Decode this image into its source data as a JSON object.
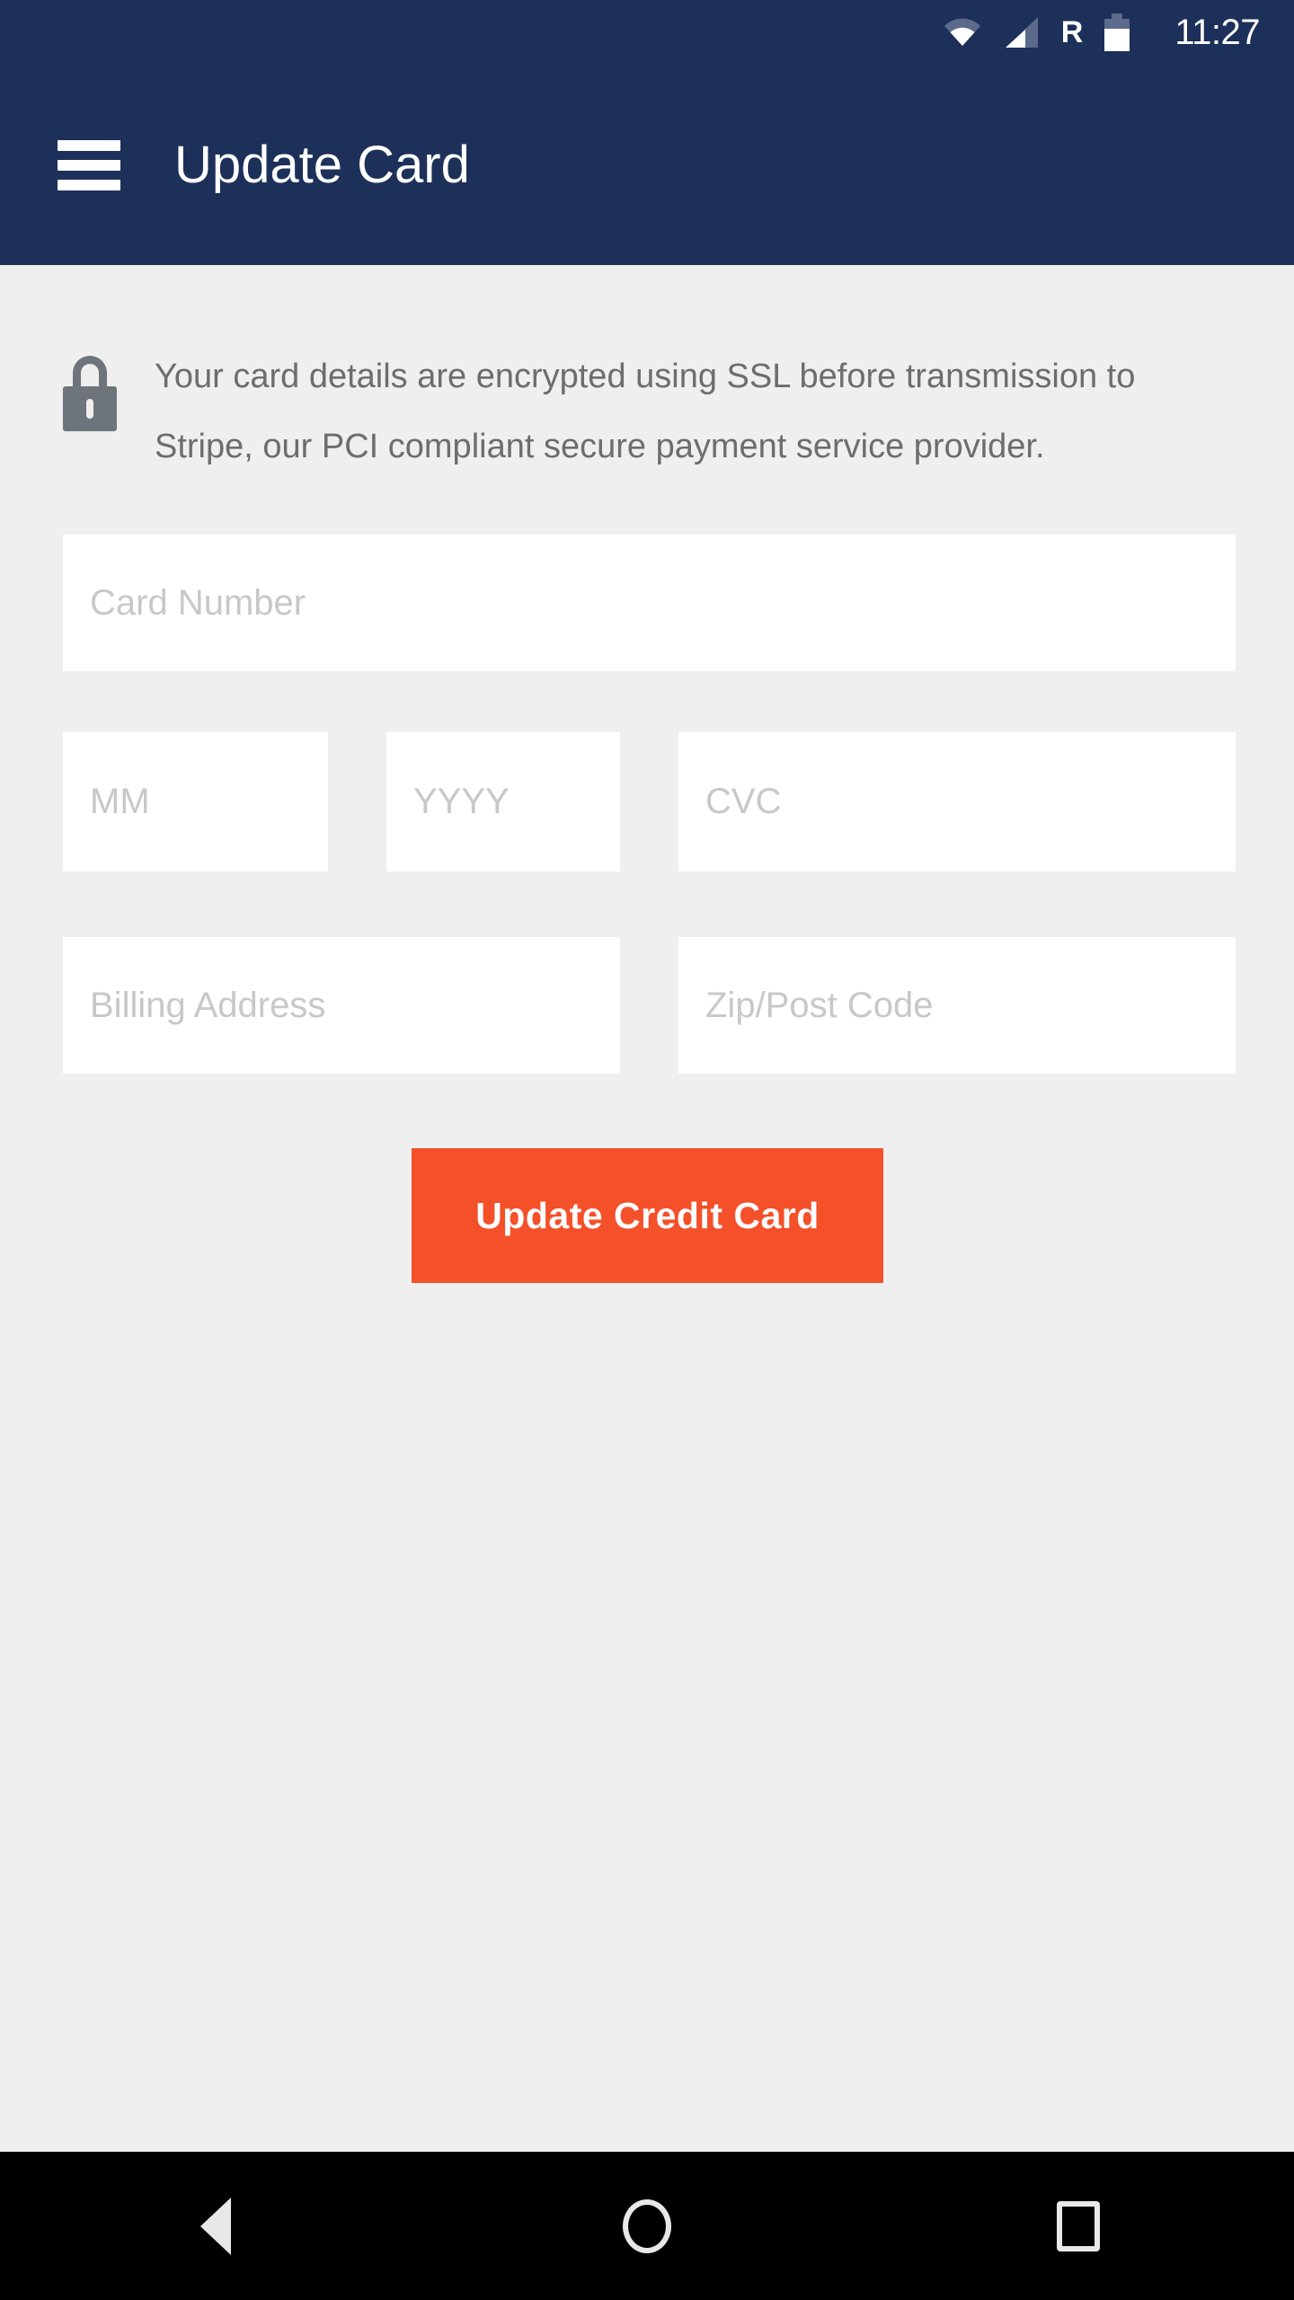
{
  "status_bar": {
    "time": "11:27",
    "roaming_indicator": "R",
    "icons": [
      "wifi-icon",
      "cell-signal-icon",
      "roaming-icon",
      "battery-icon"
    ],
    "background_color": "#1d3059",
    "foreground_color": "#ffffff"
  },
  "app_bar": {
    "title": "Update Card",
    "menu_icon": "hamburger-menu-icon",
    "background_color": "#1d3059",
    "text_color": "#ffffff"
  },
  "notice": {
    "icon": "lock-icon",
    "text": "Your card details are encrypted using SSL before transmission to Stripe, our PCI compliant secure payment service provider.",
    "text_color": "#6d6d6d",
    "icon_color": "#6e747c"
  },
  "form": {
    "fields": [
      {
        "name": "card-number",
        "placeholder": "Card Number",
        "value": ""
      },
      {
        "name": "exp-month",
        "placeholder": "MM",
        "value": ""
      },
      {
        "name": "exp-year",
        "placeholder": "YYYY",
        "value": ""
      },
      {
        "name": "cvc",
        "placeholder": "CVC",
        "value": ""
      },
      {
        "name": "billing-address",
        "placeholder": "Billing Address",
        "value": ""
      },
      {
        "name": "zip",
        "placeholder": "Zip/Post Code",
        "value": ""
      }
    ],
    "field_background": "#ffffff",
    "placeholder_color": "#c8c8c8"
  },
  "submit": {
    "label": "Update Credit Card",
    "background_color": "#f4502a",
    "text_color": "#ffffff"
  },
  "nav_bar": {
    "background_color": "#000000",
    "buttons": [
      {
        "name": "back",
        "icon": "triangle-left-icon"
      },
      {
        "name": "home",
        "icon": "circle-icon"
      },
      {
        "name": "recents",
        "icon": "square-icon"
      }
    ]
  },
  "page": {
    "background_color": "#efefef"
  }
}
